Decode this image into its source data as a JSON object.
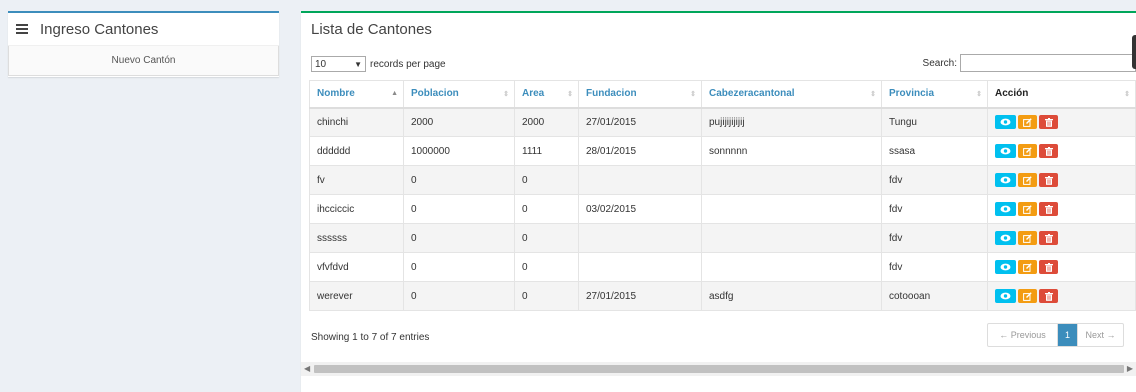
{
  "left_panel": {
    "title": "Ingreso Cantones",
    "new_button": "Nuevo Cantón"
  },
  "main": {
    "title": "Lista de Cantones",
    "length": {
      "value": "10",
      "suffix": "records per page"
    },
    "search": {
      "label": "Search:",
      "value": ""
    },
    "columns": [
      "Nombre",
      "Poblacion",
      "Area",
      "Fundacion",
      "Cabezeracantonal",
      "Provincia",
      "Acción"
    ],
    "rows": [
      [
        "chinchi",
        "2000",
        "2000",
        "27/01/2015",
        "pujijijijijij",
        "Tungu"
      ],
      [
        "dddddd",
        "1000000",
        "1111",
        "28/01/2015",
        "sonnnnn",
        "ssasa"
      ],
      [
        "fv",
        "0",
        "0",
        "",
        "",
        "fdv"
      ],
      [
        "ihcciccic",
        "0",
        "0",
        "03/02/2015",
        "",
        "fdv"
      ],
      [
        "ssssss",
        "0",
        "0",
        "",
        "",
        "fdv"
      ],
      [
        "vfvfdvd",
        "0",
        "0",
        "",
        "",
        "fdv"
      ],
      [
        "werever",
        "0",
        "0",
        "27/01/2015",
        "asdfg",
        "cotoooan"
      ]
    ],
    "info": "Showing 1 to 7 of 7 entries",
    "pagination": {
      "previous": "← Previous",
      "page": "1",
      "next": "Next →"
    }
  },
  "icons": {
    "view": "eye-icon",
    "edit": "edit-icon",
    "delete": "trash-icon",
    "menu": "hamburger-icon"
  },
  "colors": {
    "view": "#00c0ef",
    "edit": "#f39c12",
    "delete": "#dd4b39",
    "primary": "#3c8dbc",
    "success_border": "#00a65a"
  }
}
